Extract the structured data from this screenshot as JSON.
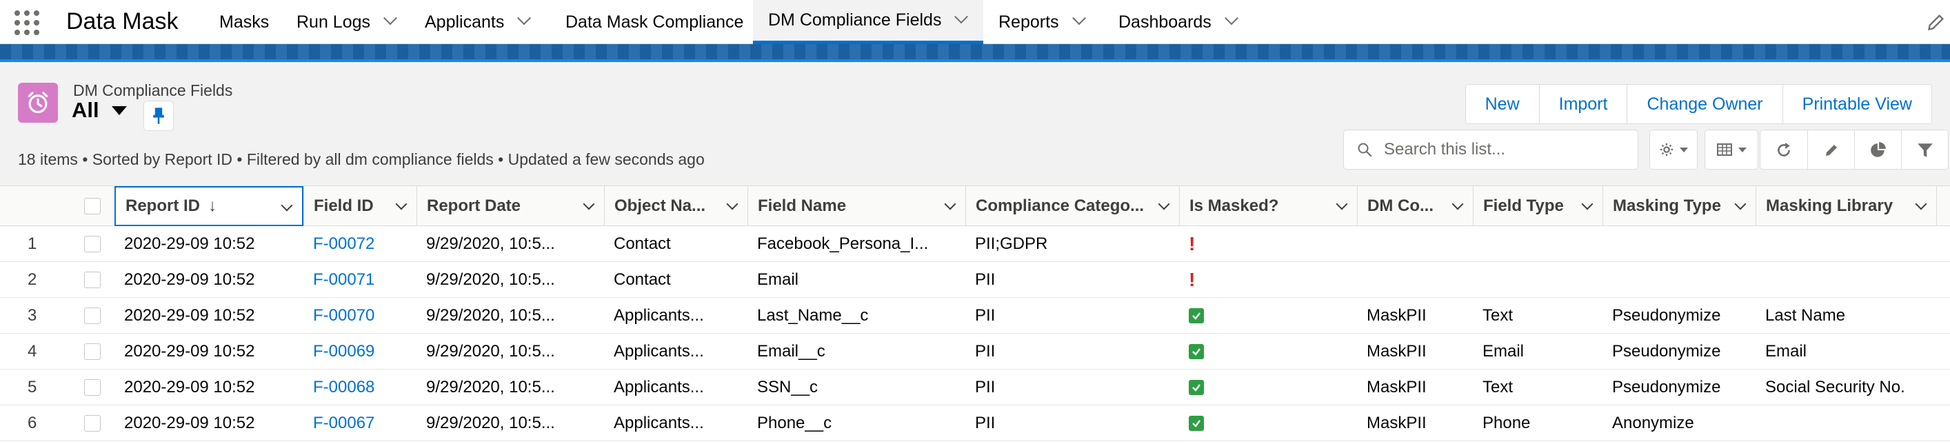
{
  "app": {
    "name": "Data Mask"
  },
  "nav": [
    {
      "label": "Masks",
      "has_menu": false
    },
    {
      "label": "Run Logs",
      "has_menu": true
    },
    {
      "label": "Applicants",
      "has_menu": true
    },
    {
      "label": "Data Mask Compliance",
      "has_menu": false
    },
    {
      "label": "DM Compliance Fields",
      "has_menu": true,
      "active": true
    },
    {
      "label": "Reports",
      "has_menu": true
    },
    {
      "label": "Dashboards",
      "has_menu": true
    }
  ],
  "list": {
    "object_label": "DM Compliance Fields",
    "view_name": "All",
    "meta": "18 items • Sorted by Report ID • Filtered by all dm compliance fields • Updated a few seconds ago",
    "actions": [
      "New",
      "Import",
      "Change Owner",
      "Printable View"
    ],
    "search_placeholder": "Search this list...",
    "sort_indicator": "↓"
  },
  "table": {
    "columns": [
      "Report ID",
      "Field ID",
      "Report Date",
      "Object Na...",
      "Field Name",
      "Compliance Catego...",
      "Is Masked?",
      "DM Co...",
      "Field Type",
      "Masking Type",
      "Masking Library"
    ],
    "rows": [
      {
        "num": "1",
        "report_id": "2020-29-09 10:52",
        "field_id": "F-00072",
        "report_date": "9/29/2020, 10:5...",
        "object_name": "Contact",
        "field_name": "Facebook_Persona_I...",
        "compliance": "PII;GDPR",
        "is_masked": "no",
        "dm_co": "",
        "field_type": "",
        "masking_type": "",
        "masking_library": ""
      },
      {
        "num": "2",
        "report_id": "2020-29-09 10:52",
        "field_id": "F-00071",
        "report_date": "9/29/2020, 10:5...",
        "object_name": "Contact",
        "field_name": "Email",
        "compliance": "PII",
        "is_masked": "no",
        "dm_co": "",
        "field_type": "",
        "masking_type": "",
        "masking_library": ""
      },
      {
        "num": "3",
        "report_id": "2020-29-09 10:52",
        "field_id": "F-00070",
        "report_date": "9/29/2020, 10:5...",
        "object_name": "Applicants...",
        "field_name": "Last_Name__c",
        "compliance": "PII",
        "is_masked": "yes",
        "dm_co": "MaskPII",
        "field_type": "Text",
        "masking_type": "Pseudonymize",
        "masking_library": "Last Name"
      },
      {
        "num": "4",
        "report_id": "2020-29-09 10:52",
        "field_id": "F-00069",
        "report_date": "9/29/2020, 10:5...",
        "object_name": "Applicants...",
        "field_name": "Email__c",
        "compliance": "PII",
        "is_masked": "yes",
        "dm_co": "MaskPII",
        "field_type": "Email",
        "masking_type": "Pseudonymize",
        "masking_library": "Email"
      },
      {
        "num": "5",
        "report_id": "2020-29-09 10:52",
        "field_id": "F-00068",
        "report_date": "9/29/2020, 10:5...",
        "object_name": "Applicants...",
        "field_name": "SSN__c",
        "compliance": "PII",
        "is_masked": "yes",
        "dm_co": "MaskPII",
        "field_type": "Text",
        "masking_type": "Pseudonymize",
        "masking_library": "Social Security No."
      },
      {
        "num": "6",
        "report_id": "2020-29-09 10:52",
        "field_id": "F-00067",
        "report_date": "9/29/2020, 10:5...",
        "object_name": "Applicants...",
        "field_name": "Phone__c",
        "compliance": "PII",
        "is_masked": "yes",
        "dm_co": "MaskPII",
        "field_type": "Phone",
        "masking_type": "Anonymize",
        "masking_library": ""
      }
    ]
  },
  "colors": {
    "accent": "#0070d2",
    "brand_bar": "#1b5f9e",
    "object_icon": "#d67bc6",
    "warning": "#e01e1e",
    "success": "#2e9e44"
  },
  "icons": [
    "app-launcher-icon",
    "edit-nav-icon",
    "alarm-clock-icon",
    "pin-icon",
    "search-icon",
    "gear-icon",
    "table-view-icon",
    "refresh-icon",
    "pencil-icon",
    "pie-chart-icon",
    "filter-icon",
    "exclamation-icon",
    "checkmark-icon"
  ]
}
